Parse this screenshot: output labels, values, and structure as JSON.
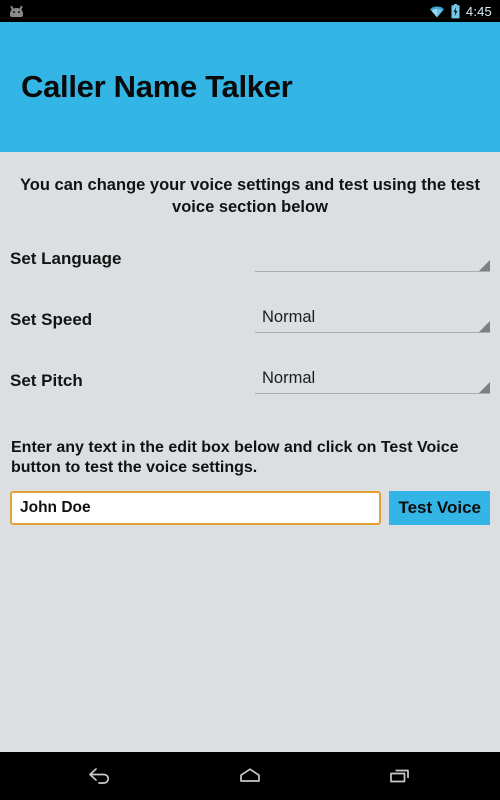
{
  "status_bar": {
    "notification_icon": "android-robot-icon",
    "wifi_icon": "wifi-icon",
    "battery_icon": "battery-charging-icon",
    "time": "4:45"
  },
  "header": {
    "title": "Caller Name Talker",
    "background_color": "#33b5e5"
  },
  "main": {
    "intro_text": "You can change your voice settings and test using the test voice section below",
    "settings": [
      {
        "label": "Set Language",
        "value": "",
        "control": "spinner"
      },
      {
        "label": "Set Speed",
        "value": "Normal",
        "control": "spinner"
      },
      {
        "label": "Set Pitch",
        "value": "Normal",
        "control": "spinner"
      }
    ],
    "test_section": {
      "description": "Enter any text in the edit box below and click on Test Voice button to test the voice settings.",
      "input_value": "John Doe",
      "input_placeholder": "",
      "button_label": "Test Voice",
      "input_focus_border_color": "#e3a136",
      "button_color": "#33b5e5"
    }
  },
  "nav_bar": {
    "back_icon": "back-arrow-icon",
    "home_icon": "home-icon",
    "recents_icon": "recent-apps-icon"
  }
}
